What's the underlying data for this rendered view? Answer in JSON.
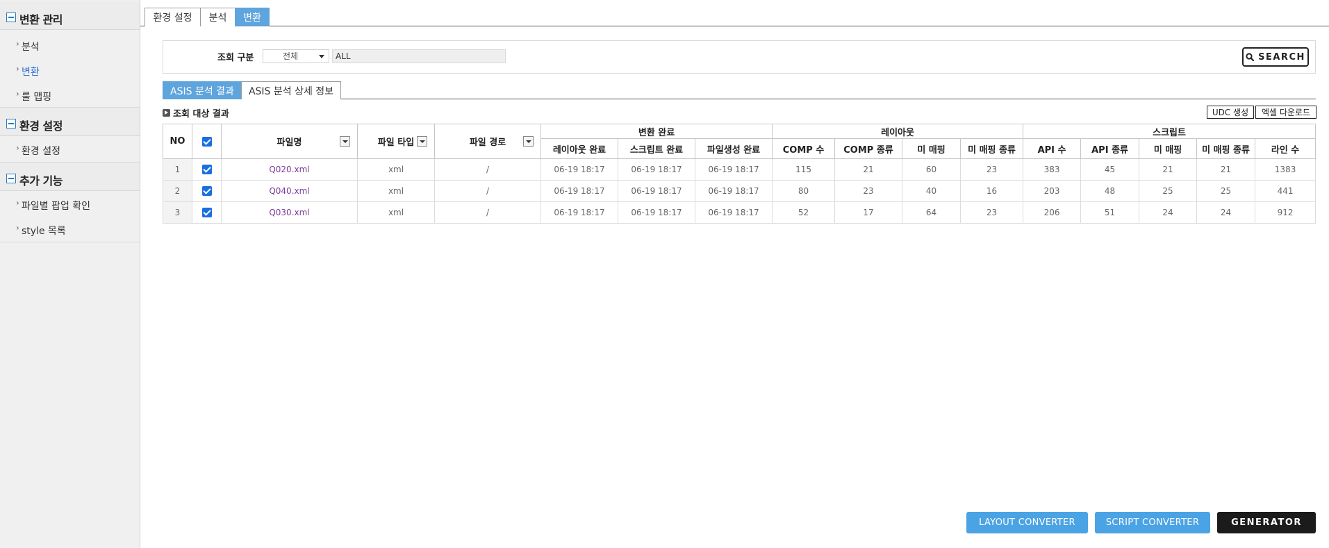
{
  "sidebar": {
    "groups": [
      {
        "title": "변환 관리",
        "items": [
          {
            "label": "분석"
          },
          {
            "label": "변환"
          },
          {
            "label": "룰 맵핑"
          }
        ]
      },
      {
        "title": "환경 설정",
        "items": [
          {
            "label": "환경 설정"
          }
        ]
      },
      {
        "title": "추가 기능",
        "items": [
          {
            "label": "파일별 팝업 확인"
          },
          {
            "label": "style 목록"
          }
        ]
      }
    ]
  },
  "top_tabs": [
    {
      "label": "환경 설정"
    },
    {
      "label": "분석"
    },
    {
      "label": "변환",
      "active": true
    }
  ],
  "search": {
    "label": "조회 구분",
    "select_value": "전체",
    "input_value": "ALL",
    "button_label": "SEARCH"
  },
  "sub_tabs": [
    {
      "label": "ASIS 분석 결과",
      "active": true
    },
    {
      "label": "ASIS 분석 상세 정보"
    }
  ],
  "result": {
    "title": "조회 대상 결과",
    "udc_button": "UDC 생성",
    "excel_button": "엑셀 다운로드"
  },
  "table": {
    "headers": {
      "no": "NO",
      "file_name": "파일명",
      "file_type": "파일 타입",
      "file_path": "파일 경로",
      "group_done": "변환 완료",
      "group_layout": "레이아웃",
      "group_script": "스크립트",
      "layout_done": "레이아웃 완료",
      "script_done": "스크립트 완료",
      "filegen_done": "파일생성 완료",
      "comp_count": "COMP 수",
      "comp_kinds": "COMP 종류",
      "unmapped": "미 매핑",
      "unmapped_kinds": "미 매핑 종류",
      "api_count": "API 수",
      "api_kinds": "API 종류",
      "s_unmapped": "미 매핑",
      "s_unmapped_kinds": "미 매핑 종류",
      "line_count": "라인 수"
    },
    "rows": [
      {
        "no": "1",
        "file": "Q020.xml",
        "type": "xml",
        "path": "/",
        "layout": "06-19 18:17",
        "script": "06-19 18:17",
        "filegen": "06-19 18:17",
        "comp": "115",
        "comp_kinds": "21",
        "unmapped": "60",
        "unmapped_kinds": "23",
        "api": "383",
        "api_kinds": "45",
        "s_unmapped": "21",
        "s_unmapped_kinds": "21",
        "lines": "1383"
      },
      {
        "no": "2",
        "file": "Q040.xml",
        "type": "xml",
        "path": "/",
        "layout": "06-19 18:17",
        "script": "06-19 18:17",
        "filegen": "06-19 18:17",
        "comp": "80",
        "comp_kinds": "23",
        "unmapped": "40",
        "unmapped_kinds": "16",
        "api": "203",
        "api_kinds": "48",
        "s_unmapped": "25",
        "s_unmapped_kinds": "25",
        "lines": "441"
      },
      {
        "no": "3",
        "file": "Q030.xml",
        "type": "xml",
        "path": "/",
        "layout": "06-19 18:17",
        "script": "06-19 18:17",
        "filegen": "06-19 18:17",
        "comp": "52",
        "comp_kinds": "17",
        "unmapped": "64",
        "unmapped_kinds": "23",
        "api": "206",
        "api_kinds": "51",
        "s_unmapped": "24",
        "s_unmapped_kinds": "24",
        "lines": "912"
      }
    ]
  },
  "bottom_buttons": {
    "layout_converter": "LAYOUT CONVERTER",
    "script_converter": "SCRIPT CONVERTER",
    "generator": "GENERATOR"
  },
  "colors": {
    "accent": "#5ea4dd",
    "button_blue": "#4aa3e4",
    "button_dark": "#1b1b1b",
    "link_purple": "#7a3a9a",
    "sidebar_active": "#2f6fd0"
  }
}
